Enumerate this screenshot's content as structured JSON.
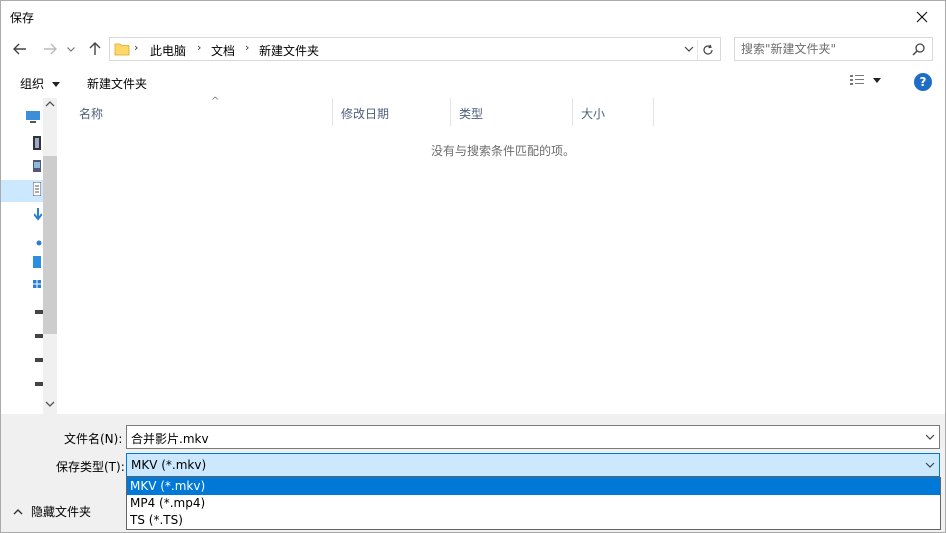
{
  "window": {
    "title": "保存"
  },
  "address_bar": {
    "crumbs": [
      "此电脑",
      "文档",
      "新建文件夹"
    ]
  },
  "search": {
    "placeholder": "搜索\"新建文件夹\""
  },
  "toolbar": {
    "organize_label": "组织",
    "new_folder_label": "新建文件夹",
    "help_label": "?"
  },
  "file_list": {
    "columns": [
      "名称",
      "修改日期",
      "类型",
      "大小"
    ],
    "empty_message": "没有与搜索条件匹配的项。"
  },
  "form": {
    "filename_label": "文件名(N):",
    "filename_value": "合并影片.mkv",
    "filetype_label": "保存类型(T):",
    "filetype_value": "MKV (*.mkv)",
    "hide_folders_label": "隐藏文件夹"
  },
  "filetype_options": [
    "MKV (*.mkv)",
    "MP4 (*.mp4)",
    "TS (*.TS)"
  ],
  "colors": {
    "accent": "#0078d7",
    "selection_bg": "#cce8ff",
    "help_icon": "#1e6ec8"
  }
}
